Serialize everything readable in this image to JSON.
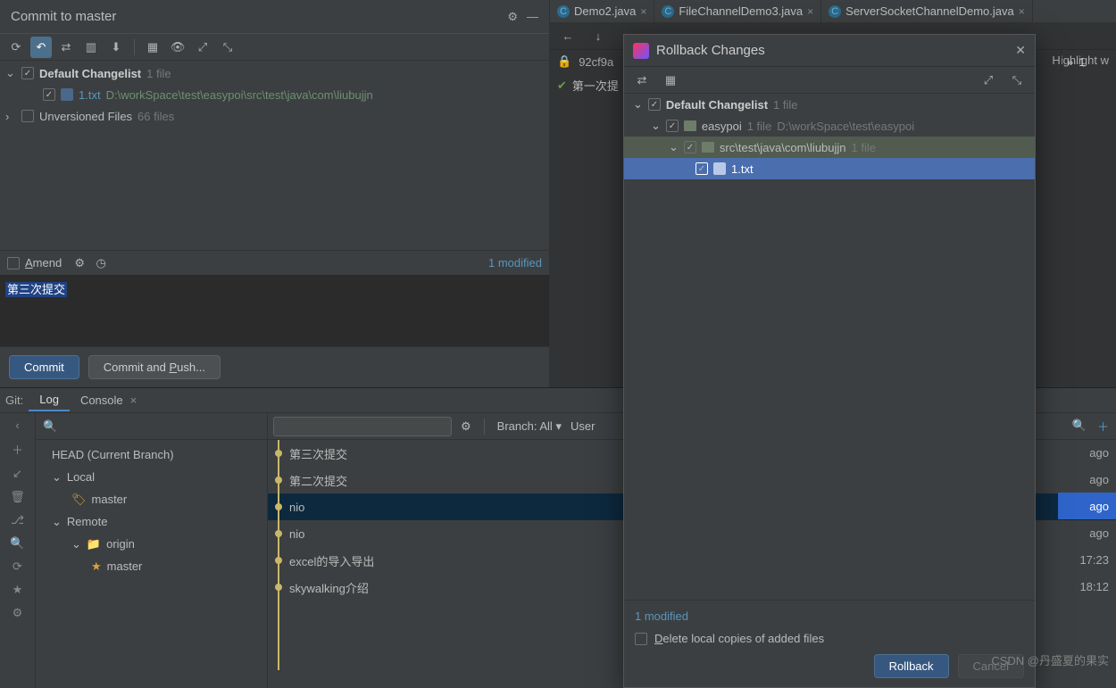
{
  "tabs": [
    {
      "label": "Demo2.java"
    },
    {
      "label": "FileChannelDemo3.java"
    },
    {
      "label": "ServerSocketChannelDemo.java"
    }
  ],
  "commit": {
    "title": "Commit to master",
    "changelist": {
      "name": "Default Changelist",
      "count": "1 file"
    },
    "file": {
      "name": "1.txt",
      "path": "D:\\workSpace\\test\\easypoi\\src\\test\\java\\com\\liubujjn"
    },
    "unversioned": {
      "label": "Unversioned Files",
      "count": "66 files"
    },
    "amend": "Amend",
    "modified": "1 modified",
    "message": "第三次提交",
    "commitBtn": "Commit",
    "commitPushBtn": "Commit and Push..."
  },
  "editor": {
    "hash": "92cf9a",
    "crumb": "第一次提",
    "highlight": "Highlight w",
    "gutter": "1"
  },
  "git": {
    "prefix": "Git:",
    "tabLog": "Log",
    "tabConsole": "Console",
    "head": "HEAD (Current Branch)",
    "local": "Local",
    "master": "master",
    "remote": "Remote",
    "origin": "origin",
    "branchLabel": "Branch:",
    "branchAll": "All",
    "user": "User",
    "commits": [
      {
        "msg": "第三次提交",
        "time": "ago"
      },
      {
        "msg": "第二次提交",
        "time": "ago"
      },
      {
        "msg": "nio",
        "time": "ago",
        "selected": true
      },
      {
        "msg": "nio",
        "time": "ago"
      },
      {
        "msg": "excel的导入导出",
        "time": "17:23"
      },
      {
        "msg": "skywalking介绍",
        "time": "18:12"
      }
    ]
  },
  "rollback": {
    "title": "Rollback Changes",
    "changelist": {
      "name": "Default Changelist",
      "count": "1 file"
    },
    "project": {
      "name": "easypoi",
      "count": "1 file",
      "path": "D:\\workSpace\\test\\easypoi"
    },
    "pkg": {
      "name": "src\\test\\java\\com\\liubujjn",
      "count": "1 file"
    },
    "file": "1.txt",
    "modified": "1 modified",
    "deleteLabel": "Delete local copies of added files",
    "rollbackBtn": "Rollback",
    "cancelBtn": "Cancel"
  },
  "watermark": "CSDN @丹盛夏的果实"
}
